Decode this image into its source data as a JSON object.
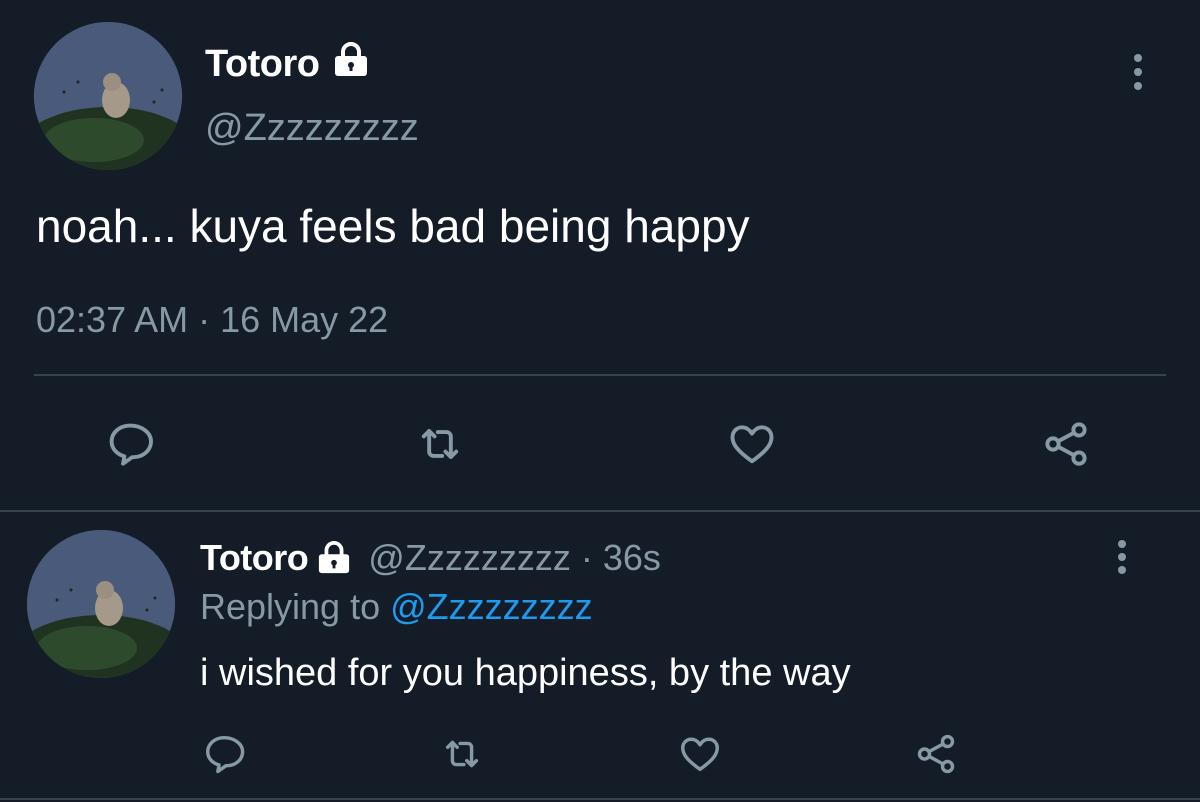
{
  "main_tweet": {
    "display_name": "Totoro",
    "handle": "@Zzzzzzzzz",
    "text": "noah... kuya feels bad being happy",
    "timestamp": "02:37 AM · 16 May 22",
    "locked": true
  },
  "reply_tweet": {
    "display_name": "Totoro",
    "handle": "@Zzzzzzzzz",
    "separator": "·",
    "age": "36s",
    "replying_prefix": "Replying to",
    "replying_handle": "@Zzzzzzzzz",
    "text": "i wished for you happiness, by the way",
    "locked": true
  },
  "colors": {
    "background": "#141c27",
    "text_primary": "#ffffff",
    "text_muted": "#8899a6",
    "link": "#1d9bf0",
    "divider": "#38444d"
  },
  "icons": [
    "lock-icon",
    "more-icon",
    "reply-icon",
    "retweet-icon",
    "like-icon",
    "share-icon"
  ]
}
